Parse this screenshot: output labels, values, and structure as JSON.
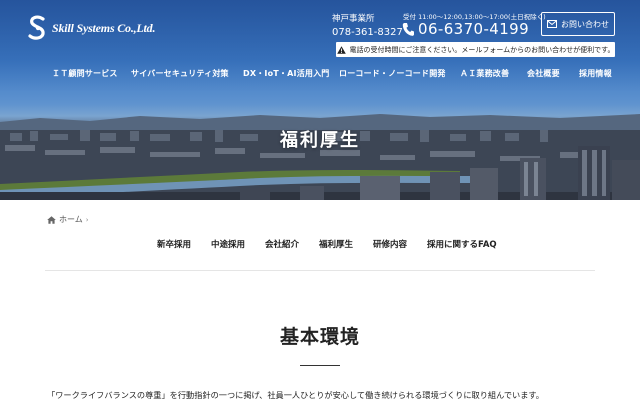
{
  "header": {
    "logo_text": "Skill Systems Co.,Ltd.",
    "office_name": "神戸事業所",
    "office_tel": "078-361-8327",
    "reception_hours": "受付 11:00～12:00,13:00～17:00(土日祝除く)",
    "main_tel": "06-6370-4199",
    "contact_label": "お問い合わせ",
    "notice": "電話の受付時間にご注意ください。メールフォームからのお問い合わせが便利です。"
  },
  "nav": {
    "items": [
      {
        "label": "ＩＴ顧問サービス"
      },
      {
        "label": "サイバーセキュリティ対策"
      },
      {
        "label": "DX・IoT・AI活用入門"
      },
      {
        "label": "ローコード・ノーコード開発"
      },
      {
        "label": "ＡＩ業務改善"
      },
      {
        "label": "会社概要"
      },
      {
        "label": "採用情報"
      }
    ]
  },
  "hero": {
    "title": "福利厚生"
  },
  "breadcrumb": {
    "home": "ホーム",
    "separator": "›"
  },
  "subnav": {
    "items": [
      {
        "label": "新卒採用"
      },
      {
        "label": "中途採用"
      },
      {
        "label": "会社紹介"
      },
      {
        "label": "福利厚生"
      },
      {
        "label": "研修内容"
      },
      {
        "label": "採用に関するFAQ"
      }
    ]
  },
  "content": {
    "heading": "基本環境",
    "body": "「ワークライフバランスの尊重」を行動指針の一つに掲げ、社員一人ひとりが安心して働き続けられる環境づくりに取り組んでいます。"
  },
  "colors": {
    "sky": "#3b78c4",
    "text": "#222222",
    "white": "#ffffff"
  },
  "icons": [
    "logo-mark-icon",
    "phone-icon",
    "mail-icon",
    "warning-icon",
    "home-icon"
  ]
}
